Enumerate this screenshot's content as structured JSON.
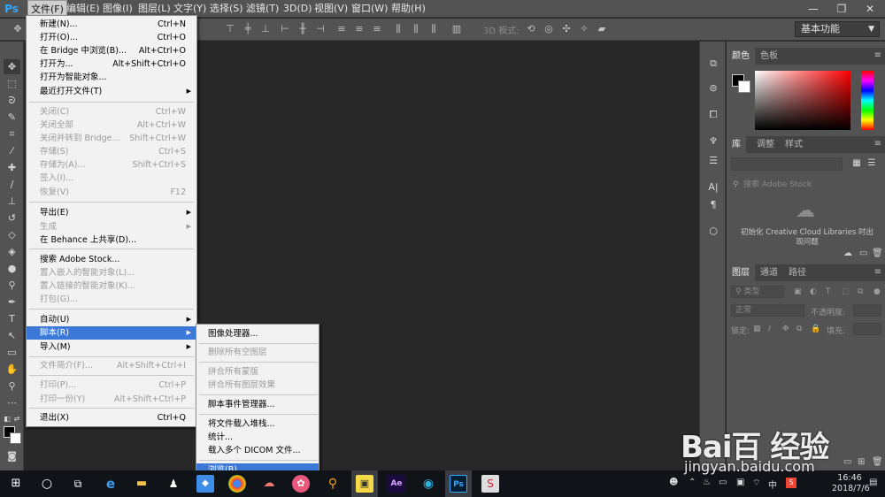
{
  "app": {
    "logo": "Ps"
  },
  "menubar": {
    "items": [
      "文件(F)",
      "编辑(E)",
      "图像(I)",
      "图层(L)",
      "文字(Y)",
      "选择(S)",
      "滤镜(T)",
      "3D(D)",
      "视图(V)",
      "窗口(W)",
      "帮助(H)"
    ],
    "active_index": 0,
    "window_controls": [
      "—",
      "❐",
      "✕"
    ]
  },
  "options_bar": {
    "mode_3d_label": "3D 模式:",
    "workspace": "基本功能"
  },
  "file_menu": {
    "items": [
      {
        "label": "新建(N)...",
        "shortcut": "Ctrl+N",
        "enabled": true
      },
      {
        "label": "打开(O)...",
        "shortcut": "Ctrl+O",
        "enabled": true
      },
      {
        "label": "在 Bridge 中浏览(B)...",
        "shortcut": "Alt+Ctrl+O",
        "enabled": true
      },
      {
        "label": "打开为...",
        "shortcut": "Alt+Shift+Ctrl+O",
        "enabled": true
      },
      {
        "label": "打开为智能对象...",
        "shortcut": "",
        "enabled": true
      },
      {
        "label": "最近打开文件(T)",
        "shortcut": "",
        "enabled": true,
        "submenu": true
      },
      {
        "label": "关闭(C)",
        "shortcut": "Ctrl+W",
        "enabled": false
      },
      {
        "label": "关闭全部",
        "shortcut": "Alt+Ctrl+W",
        "enabled": false
      },
      {
        "label": "关闭并转到 Bridge...",
        "shortcut": "Shift+Ctrl+W",
        "enabled": false
      },
      {
        "label": "存储(S)",
        "shortcut": "Ctrl+S",
        "enabled": false
      },
      {
        "label": "存储为(A)...",
        "shortcut": "Shift+Ctrl+S",
        "enabled": false
      },
      {
        "label": "签入(I)...",
        "shortcut": "",
        "enabled": false
      },
      {
        "label": "恢复(V)",
        "shortcut": "F12",
        "enabled": false
      },
      {
        "label": "导出(E)",
        "shortcut": "",
        "enabled": true,
        "submenu": true
      },
      {
        "label": "生成",
        "shortcut": "",
        "enabled": false,
        "submenu": true
      },
      {
        "label": "在 Behance 上共享(D)...",
        "shortcut": "",
        "enabled": true
      },
      {
        "label": "搜索 Adobe Stock...",
        "shortcut": "",
        "enabled": true
      },
      {
        "label": "置入嵌入的智能对象(L)...",
        "shortcut": "",
        "enabled": false
      },
      {
        "label": "置入链接的智能对象(K)...",
        "shortcut": "",
        "enabled": false
      },
      {
        "label": "打包(G)...",
        "shortcut": "",
        "enabled": false
      },
      {
        "label": "自动(U)",
        "shortcut": "",
        "enabled": true,
        "submenu": true
      },
      {
        "label": "脚本(R)",
        "shortcut": "",
        "enabled": true,
        "submenu": true,
        "highlighted": true
      },
      {
        "label": "导入(M)",
        "shortcut": "",
        "enabled": true,
        "submenu": true
      },
      {
        "label": "文件简介(F)...",
        "shortcut": "Alt+Shift+Ctrl+I",
        "enabled": false
      },
      {
        "label": "打印(P)...",
        "shortcut": "Ctrl+P",
        "enabled": false
      },
      {
        "label": "打印一份(Y)",
        "shortcut": "Alt+Shift+Ctrl+P",
        "enabled": false
      },
      {
        "label": "退出(X)",
        "shortcut": "Ctrl+Q",
        "enabled": true
      }
    ]
  },
  "script_menu": {
    "items": [
      {
        "label": "图像处理器...",
        "enabled": true
      },
      {
        "label": "删除所有空图层",
        "enabled": false
      },
      {
        "label": "拼合所有蒙版",
        "enabled": false
      },
      {
        "label": "拼合所有图层效果",
        "enabled": false
      },
      {
        "label": "脚本事件管理器...",
        "enabled": true
      },
      {
        "label": "将文件载入堆栈...",
        "enabled": true
      },
      {
        "label": "统计...",
        "enabled": true
      },
      {
        "label": "载入多个 DICOM 文件...",
        "enabled": true
      },
      {
        "label": "浏览(B)...",
        "enabled": true,
        "highlighted": true
      }
    ]
  },
  "panels": {
    "color_tabs": [
      "颜色",
      "色板"
    ],
    "library_tabs": [
      "库",
      "调整",
      "样式"
    ],
    "library_search_placeholder": "搜索 Adobe Stock",
    "library_message": "初始化 Creative Cloud Libraries 时出现问题",
    "layers_tabs": [
      "图层",
      "通道",
      "路径"
    ],
    "layers_kind": "类型",
    "blend_mode": "正常",
    "opacity_label": "不透明度:",
    "lock_label": "锁定:",
    "fill_label": "填充:"
  },
  "taskbar": {
    "time": "16:46",
    "date": "2018/7/6",
    "ime": "中"
  },
  "watermark": {
    "logo": "Bai百 经验",
    "url": "jingyan.baidu.com"
  },
  "colors": {
    "ps_blue": "#31a8ff",
    "menu_highlight": "#3c78d8",
    "panel_bg": "#535353",
    "canvas_bg": "#282828"
  }
}
